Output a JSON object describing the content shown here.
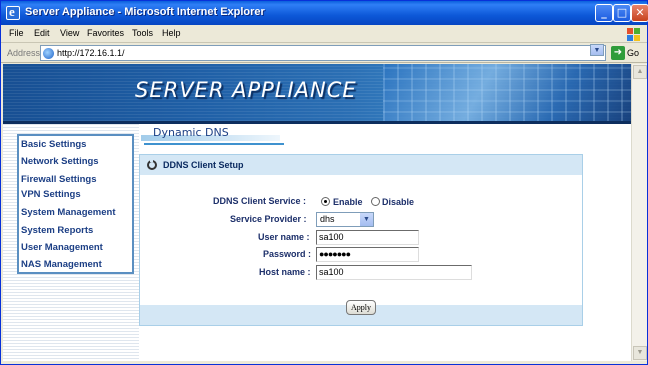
{
  "window": {
    "title": "Server Appliance - Microsoft Internet Explorer",
    "min": "_",
    "max": "□",
    "close": "✕"
  },
  "menu": [
    "File",
    "Edit",
    "View",
    "Favorites",
    "Tools",
    "Help"
  ],
  "address": {
    "label": "Address",
    "url": "http://172.16.1.1/",
    "go": "Go"
  },
  "banner": {
    "title": "SERVER APPLIANCE"
  },
  "nav": [
    "Basic Settings",
    "Network Settings",
    "Firewall Settings",
    "VPN Settings",
    "System Management",
    "System Reports",
    "User Management",
    "NAS Management"
  ],
  "page": {
    "heading": "Dynamic DNS"
  },
  "panel": {
    "title": "DDNS Client Setup",
    "service_label": "DDNS Client Service :",
    "enable_label": "Enable",
    "disable_label": "Disable",
    "service_enabled": true,
    "provider_label": "Service Provider :",
    "provider_value": "dhs",
    "username_label": "User name :",
    "username_value": "sa100",
    "password_label": "Password :",
    "password_value": "●●●●●●●",
    "hostname_label": "Host name :",
    "hostname_value": "sa100",
    "apply_label": "Apply"
  },
  "icons": {
    "app": "ie-icon",
    "favicon": "ie-page-icon",
    "windows_flag": "windows-logo-icon",
    "panel": "refresh-circle-icon",
    "go": "go-arrow-icon"
  }
}
